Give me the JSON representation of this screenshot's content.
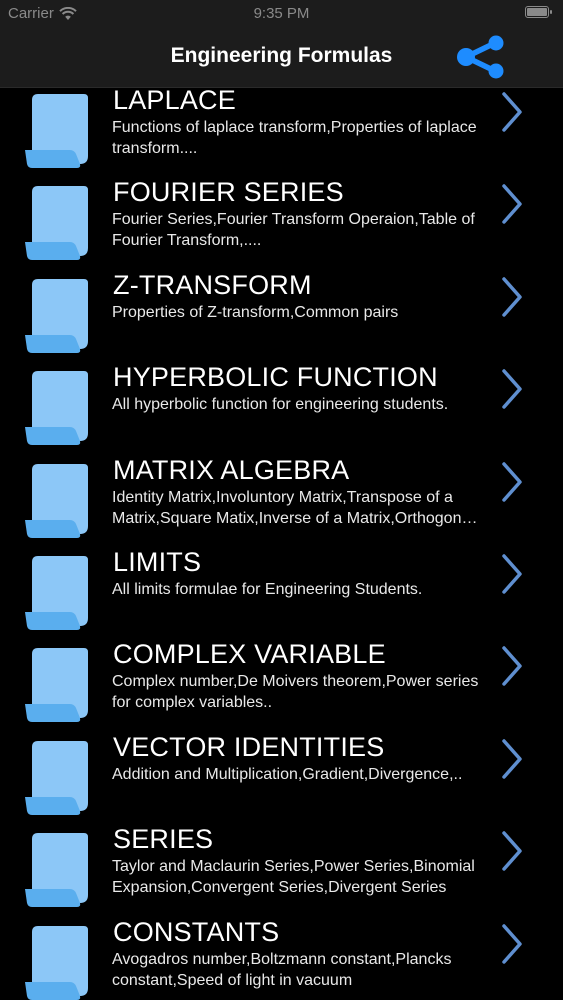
{
  "status_bar": {
    "carrier": "Carrier",
    "time": "9:35 PM",
    "battery_level": 1.0
  },
  "nav": {
    "title": "Engineering Formulas",
    "share_icon": "share-icon"
  },
  "colors": {
    "accent": "#1e8cff",
    "doc_icon": "#8cc7f7",
    "doc_icon_dark": "#5aaeee",
    "chevron": "#5f8fd0",
    "background": "#000000",
    "bar": "#1c1c1c"
  },
  "items": [
    {
      "title": "LAPLACE",
      "description": "Functions of laplace transform,Properties of laplace transform....",
      "icon": "document-icon"
    },
    {
      "title": "FOURIER SERIES",
      "description": "Fourier Series,Fourier Transform Operaion,Table of Fourier Transform,....",
      "icon": "document-icon"
    },
    {
      "title": "Z-TRANSFORM",
      "description": "Properties of Z-transform,Common pairs",
      "icon": "document-icon"
    },
    {
      "title": "HYPERBOLIC FUNCTION",
      "description": "All hyperbolic function for engineering students.",
      "icon": "document-icon"
    },
    {
      "title": "MATRIX ALGEBRA",
      "description": "Identity Matrix,Involuntory Matrix,Transpose of a Matrix,Square Matix,Inverse of a Matrix,Orthogonal Matrix",
      "icon": "document-icon"
    },
    {
      "title": "LIMITS",
      "description": "All limits formulae for Engineering Students.",
      "icon": "document-icon"
    },
    {
      "title": "COMPLEX VARIABLE",
      "description": "Complex number,De Moivers theorem,Power series for complex variables..",
      "icon": "document-icon"
    },
    {
      "title": "VECTOR IDENTITIES",
      "description": "Addition and Multiplication,Gradient,Divergence,..",
      "icon": "document-icon"
    },
    {
      "title": "SERIES",
      "description": "Taylor and Maclaurin Series,Power Series,Binomial Expansion,Convergent Series,Divergent Series",
      "icon": "document-icon"
    },
    {
      "title": "CONSTANTS",
      "description": "Avogadros number,Boltzmann constant,Plancks constant,Speed of light in vacuum",
      "icon": "document-icon"
    }
  ]
}
